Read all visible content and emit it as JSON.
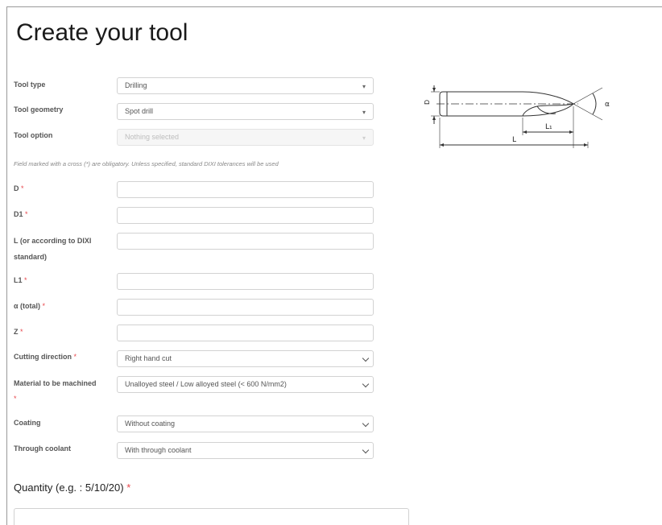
{
  "page": {
    "title": "Create your tool"
  },
  "form": {
    "tool_type": {
      "label": "Tool type",
      "value": "Drilling"
    },
    "tool_geometry": {
      "label": "Tool geometry",
      "value": "Spot drill"
    },
    "tool_option": {
      "label": "Tool option",
      "placeholder": "Nothing selected"
    },
    "note": "Field marked with a cross (*) are obligatory. Unless specified, standard DIXI tolerances will be used",
    "d": {
      "label": "D",
      "value": ""
    },
    "d1": {
      "label": "D1",
      "value": ""
    },
    "l": {
      "label": "L (or according to DIXI standard)",
      "value": ""
    },
    "l1": {
      "label": "L1",
      "value": ""
    },
    "alpha": {
      "label": "α (total)",
      "value": ""
    },
    "z": {
      "label": "Z",
      "value": ""
    },
    "cutting_direction": {
      "label": "Cutting direction",
      "value": "Right hand cut"
    },
    "material": {
      "label": "Material to be machined",
      "value": "Unalloyed steel / Low alloyed steel (< 600 N/mm2)"
    },
    "coating": {
      "label": "Coating",
      "value": "Without coating"
    },
    "coolant": {
      "label": "Through coolant",
      "value": "With through coolant"
    },
    "required_mark": "*",
    "quantity": {
      "label": "Quantity (e.g. : 5/10/20)",
      "value": ""
    }
  },
  "diagram": {
    "label_d": "D",
    "label_alpha": "α",
    "label_l1": "L₁",
    "label_l": "L"
  }
}
